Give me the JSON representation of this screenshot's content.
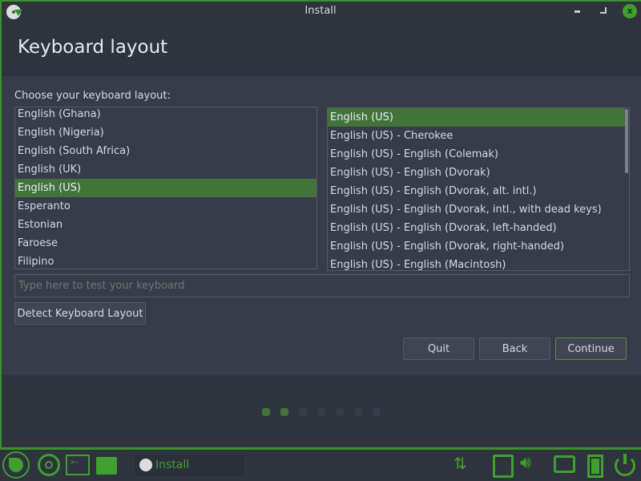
{
  "window": {
    "title": "Install"
  },
  "header": {
    "title": "Keyboard layout"
  },
  "main": {
    "prompt": "Choose your keyboard layout:",
    "layouts": [
      "English (Ghana)",
      "English (Nigeria)",
      "English (South Africa)",
      "English (UK)",
      "English (US)",
      "Esperanto",
      "Estonian",
      "Faroese",
      "Filipino"
    ],
    "selected_layout_index": 4,
    "variants": [
      "English (US)",
      "English (US) - Cherokee",
      "English (US) - English (Colemak)",
      "English (US) - English (Dvorak)",
      "English (US) - English (Dvorak, alt. intl.)",
      "English (US) - English (Dvorak, intl., with dead keys)",
      "English (US) - English (Dvorak, left-handed)",
      "English (US) - English (Dvorak, right-handed)",
      "English (US) - English (Macintosh)"
    ],
    "selected_variant_index": 0,
    "test_placeholder": "Type here to test your keyboard",
    "detect_label": "Detect Keyboard Layout"
  },
  "buttons": {
    "quit": "Quit",
    "back": "Back",
    "continue": "Continue"
  },
  "progress": {
    "current_step": 2,
    "total_steps": 7
  },
  "taskbar": {
    "task_label": "Install"
  },
  "colors": {
    "accent": "#41733a",
    "frame": "#3f8f2f",
    "bg": "#383c4a"
  }
}
